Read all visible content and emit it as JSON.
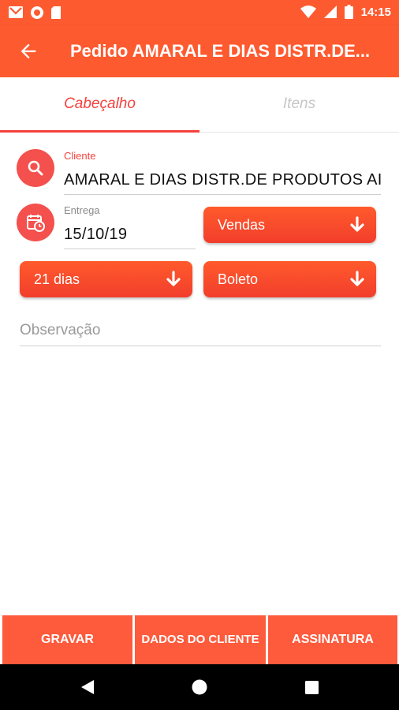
{
  "status_bar": {
    "time": "14:15",
    "left_icons": [
      "gmail-icon",
      "record-icon",
      "sd-card-icon"
    ],
    "right_icons": [
      "wifi-icon",
      "signal-icon",
      "battery-icon"
    ]
  },
  "app_bar": {
    "back_icon": "arrow-left-icon",
    "title": "Pedido AMARAL E DIAS DISTR.DE..."
  },
  "tabs": [
    {
      "label": "Cabeçalho",
      "active": true
    },
    {
      "label": "Itens",
      "active": false
    }
  ],
  "form": {
    "cliente": {
      "label": "Cliente",
      "value": "AMARAL E DIAS DISTR.DE PRODUTOS AI",
      "icon": "search-icon"
    },
    "entrega": {
      "label": "Entrega",
      "value": "15/10/19",
      "icon": "calendar-clock-icon"
    },
    "tipo": {
      "selected": "Vendas"
    },
    "prazo": {
      "selected": "21 dias"
    },
    "pagamento": {
      "selected": "Boleto"
    },
    "observacao": {
      "placeholder": "Observação"
    }
  },
  "bottom_buttons": {
    "gravar": "GRAVAR",
    "dados_cliente": "DADOS DO CLIENTE",
    "assinatura": "ASSINATURA"
  },
  "nav_bar": {
    "buttons": [
      "back-triangle-icon",
      "home-circle-icon",
      "recents-square-icon"
    ]
  },
  "colors": {
    "primary": "#fe5a2f",
    "accent": "#f4413d",
    "button": "#fe5a3c"
  }
}
